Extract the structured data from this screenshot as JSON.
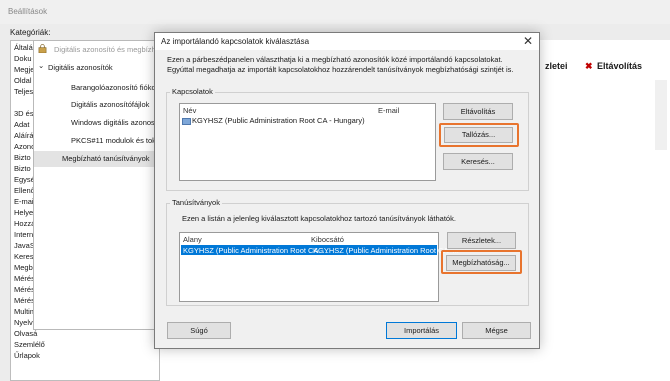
{
  "background_window": {
    "title": "Beállítások",
    "categories_label": "Kategóriák:",
    "categories": [
      "Általá",
      "Doku",
      "Megje",
      "Oldal",
      "Teljes",
      "3D és",
      "Adat",
      "Aláírá",
      "Azono",
      "Bizto",
      "Bizto",
      "Egysé",
      "Ellenő",
      "E-mail",
      "Helye",
      "Hozzá",
      "Intern",
      "JavaSc",
      "Keresé",
      "Megbi",
      "Mérés",
      "Mérés",
      "Mérés",
      "Multim",
      "Nyelv",
      "Olvasá",
      "Szemlélő",
      "Űrlapok"
    ],
    "right_strip": {
      "details_label": "zletei",
      "remove_label": "Eltávolítás"
    }
  },
  "middle_dialog": {
    "title": "Digitális azonosító és megbízható ta",
    "items": [
      {
        "label": "Digitális azonosítók"
      },
      {
        "label": "Barangolóazonosító fiókok"
      },
      {
        "label": "Digitális azonosítófájlok"
      },
      {
        "label": "Windows digitális azonosító"
      },
      {
        "label": "PKCS#11 modulok és tokene"
      },
      {
        "label": "Megbízható tanúsítványok"
      }
    ]
  },
  "dialog": {
    "title": "Az importálandó kapcsolatok kiválasztása",
    "description": "Ezen a párbeszédpanelen választhatja ki a megbízható azonosítók közé importálandó kapcsolatokat. Egyúttal megadhatja az importált kapcsolatokhoz hozzárendelt tanúsítványok megbízhatósági szintjét is.",
    "contacts_group": {
      "label": "Kapcsolatok",
      "columns": [
        "Név",
        "E-mail"
      ],
      "rows": [
        {
          "name": "KGYHSZ (Public Administration Root CA - Hungary)",
          "email": ""
        }
      ],
      "buttons": {
        "remove": "Eltávolítás",
        "browse": "Tallózás...",
        "search": "Keresés..."
      }
    },
    "certs_group": {
      "label": "Tanúsítványok",
      "hint": "Ezen a listán a jelenleg kiválasztott kapcsolatokhoz tartozó tanúsítványok láthatók.",
      "columns": [
        "Alany",
        "Kibocsátó"
      ],
      "rows": [
        {
          "subject": "KGYHSZ (Public Administration Root CA -...",
          "issuer": "KGYHSZ (Public Administration Root CA -..."
        }
      ],
      "buttons": {
        "details": "Részletek...",
        "trust": "Megbízhatóság..."
      }
    },
    "footer": {
      "help": "Súgó",
      "import": "Importálás",
      "cancel": "Mégse"
    }
  },
  "colors": {
    "selection": "#0078d7",
    "highlight": "#e8742e"
  }
}
